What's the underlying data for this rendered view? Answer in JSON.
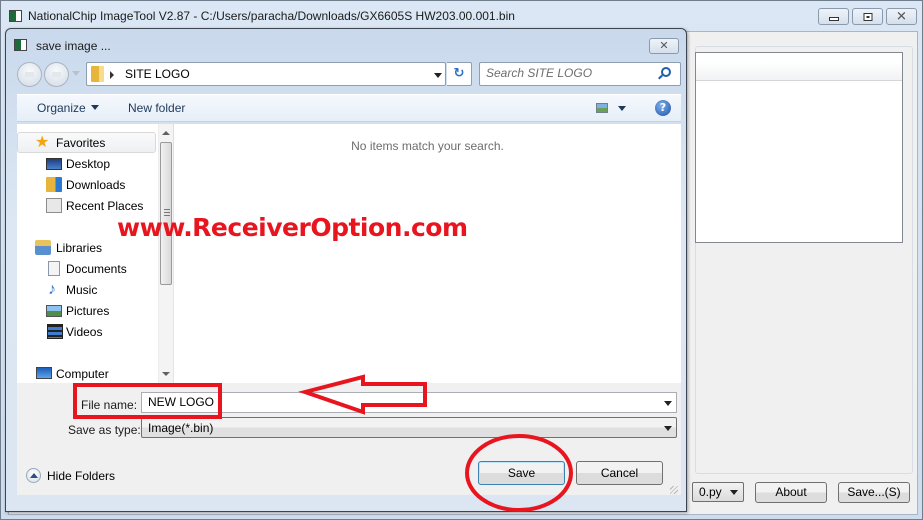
{
  "app": {
    "title": "NationalChip ImageTool V2.87 - C:/Users/paracha/Downloads/GX6605S HW203.00.001.bin",
    "window_controls": {
      "minimize": "minimize-icon",
      "maximize": "maximize-icon",
      "close": "close-icon"
    },
    "combo_value": "0.py",
    "about_label": "About",
    "save_label": "Save...(S)"
  },
  "dialog": {
    "title": "save image ...",
    "close_glyph": "✕",
    "address": {
      "current_folder": "SITE LOGO"
    },
    "search": {
      "placeholder": "Search SITE LOGO"
    },
    "toolbar": {
      "organize": "Organize",
      "new_folder": "New folder",
      "help_glyph": "?"
    },
    "nav_pane": {
      "favorites": {
        "label": "Favorites",
        "icon": "star-icon"
      },
      "favorite_items": [
        {
          "label": "Desktop",
          "icon": "desktop-icon"
        },
        {
          "label": "Downloads",
          "icon": "downloads-icon"
        },
        {
          "label": "Recent Places",
          "icon": "recent-places-icon"
        }
      ],
      "libraries": {
        "label": "Libraries",
        "icon": "libraries-icon"
      },
      "library_items": [
        {
          "label": "Documents",
          "icon": "documents-icon"
        },
        {
          "label": "Music",
          "icon": "music-icon"
        },
        {
          "label": "Pictures",
          "icon": "pictures-icon"
        },
        {
          "label": "Videos",
          "icon": "videos-icon"
        }
      ],
      "computer": {
        "label": "Computer",
        "icon": "computer-icon"
      }
    },
    "file_pane": {
      "empty_message": "No items match your search."
    },
    "file_name": {
      "label": "File name:",
      "value": "NEW LOGO"
    },
    "save_as_type": {
      "label": "Save as type:",
      "value": "Image(*.bin)"
    },
    "hide_folders": "Hide Folders",
    "save_button": "Save",
    "cancel_button": "Cancel"
  },
  "annotations": {
    "watermark": "www.ReceiverOption.com",
    "highlight_color": "#e8151f"
  }
}
